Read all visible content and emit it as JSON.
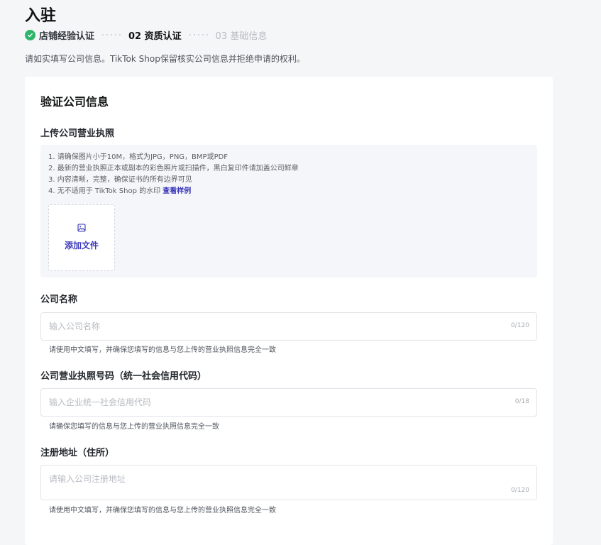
{
  "page": {
    "title": "入驻",
    "notice": "请如实填写公司信息。TikTok Shop保留核实公司信息并拒绝申请的权利。"
  },
  "steps": [
    {
      "label": "店铺经验认证",
      "state": "done"
    },
    {
      "label": "02 资质认证",
      "state": "current"
    },
    {
      "label": "03 基础信息",
      "state": "todo"
    }
  ],
  "form": {
    "title": "验证公司信息",
    "license": {
      "label": "上传公司营业执照",
      "requirements": [
        "1. 请确保图片小于10M，格式为JPG，PNG，BMP或PDF",
        "2. 最新的营业执照正本或副本的彩色照片或扫描件，黑白复印件请加盖公司鲜章",
        "3. 内容清晰，完整，确保证书的所有边界可见",
        "4. 无不适用于 TikTok Shop 的水印"
      ],
      "sample_link": "查看样例",
      "upload_label": "添加文件"
    },
    "company_name": {
      "label": "公司名称",
      "placeholder": "输入公司名称",
      "counter": "0/120",
      "hint": "请使用中文填写，并确保您填写的信息与您上传的营业执照信息完全一致"
    },
    "license_number": {
      "label": "公司营业执照号码（统一社会信用代码）",
      "placeholder": "输入企业统一社会信用代码",
      "counter": "0/18",
      "hint": "请确保您填写的信息与您上传的营业执照信息完全一致"
    },
    "address": {
      "label": "注册地址（住所）",
      "placeholder": "请输入公司注册地址",
      "counter": "0/120",
      "hint": "请使用中文填写，并确保您填写的信息与您上传的营业执照信息完全一致"
    }
  },
  "colors": {
    "accent": "#3b37b9",
    "success": "#2fb56a"
  }
}
